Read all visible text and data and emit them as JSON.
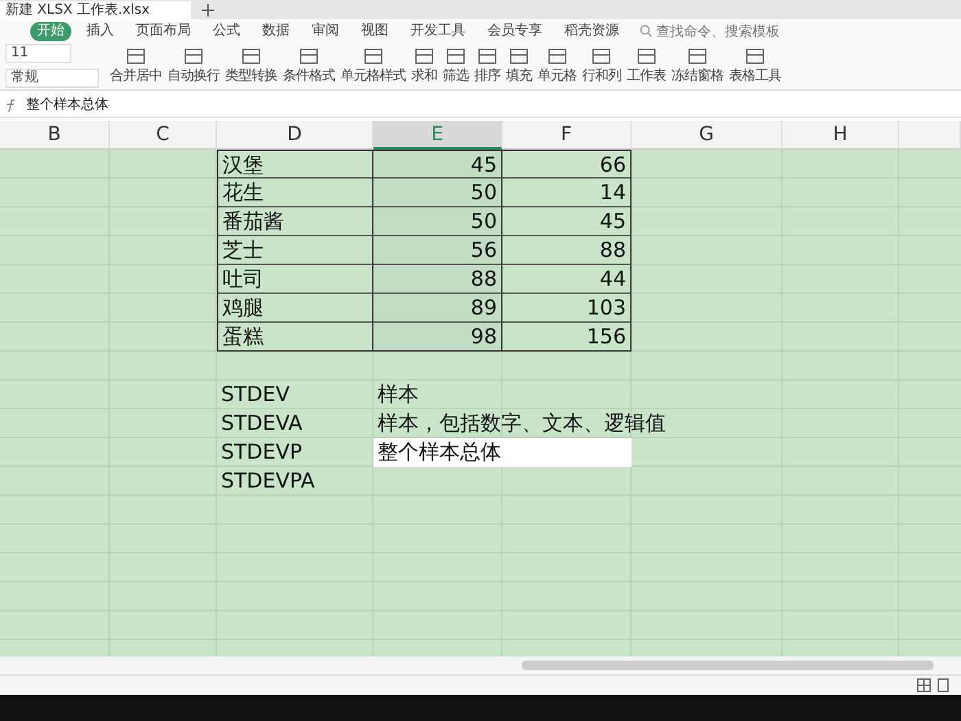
{
  "window": {
    "tab_title": "新建 XLSX 工作表.xlsx"
  },
  "menu_tabs": [
    {
      "label": "开始",
      "selected": true
    },
    {
      "label": "插入",
      "selected": false
    },
    {
      "label": "页面布局",
      "selected": false
    },
    {
      "label": "公式",
      "selected": false
    },
    {
      "label": "数据",
      "selected": false
    },
    {
      "label": "审阅",
      "selected": false
    },
    {
      "label": "视图",
      "selected": false
    },
    {
      "label": "开发工具",
      "selected": false
    },
    {
      "label": "会员专享",
      "selected": false
    },
    {
      "label": "稻壳资源",
      "selected": false
    }
  ],
  "search": {
    "placeholder": "查找命令、搜索模板"
  },
  "ribbon": {
    "font_size": "11",
    "number_format": "常规",
    "commands": [
      "合并居中",
      "自动换行",
      "类型转换",
      "条件格式",
      "单元格样式",
      "求和",
      "筛选",
      "排序",
      "填充",
      "单元格",
      "行和列",
      "工作表",
      "冻结窗格",
      "表格工具"
    ]
  },
  "formula_bar": {
    "value": "整个样本总体"
  },
  "columns": [
    {
      "label": "B",
      "selected": false
    },
    {
      "label": "C",
      "selected": false
    },
    {
      "label": "D",
      "selected": false
    },
    {
      "label": "E",
      "selected": true
    },
    {
      "label": "F",
      "selected": false
    },
    {
      "label": "G",
      "selected": false
    },
    {
      "label": "H",
      "selected": false
    }
  ],
  "table": {
    "rows": [
      {
        "name": "汉堡",
        "column_e": "45",
        "column_f": "66"
      },
      {
        "name": "花生",
        "column_e": "50",
        "column_f": "14"
      },
      {
        "name": "番茄酱",
        "column_e": "50",
        "column_f": "45"
      },
      {
        "name": "芝士",
        "column_e": "56",
        "column_f": "88"
      },
      {
        "name": "吐司",
        "column_e": "88",
        "column_f": "44"
      },
      {
        "name": "鸡腿",
        "column_e": "89",
        "column_f": "103"
      },
      {
        "name": "蛋糕",
        "column_e": "98",
        "column_f": "156"
      }
    ]
  },
  "notes": [
    {
      "function": "STDEV",
      "description": "样本",
      "editing": false
    },
    {
      "function": "STDEVA",
      "description": "样本，包括数字、文本、逻辑值",
      "editing": false
    },
    {
      "function": "STDEVP",
      "description": "整个样本总体",
      "editing": true
    },
    {
      "function": "STDEVPA",
      "editing": false
    }
  ]
}
